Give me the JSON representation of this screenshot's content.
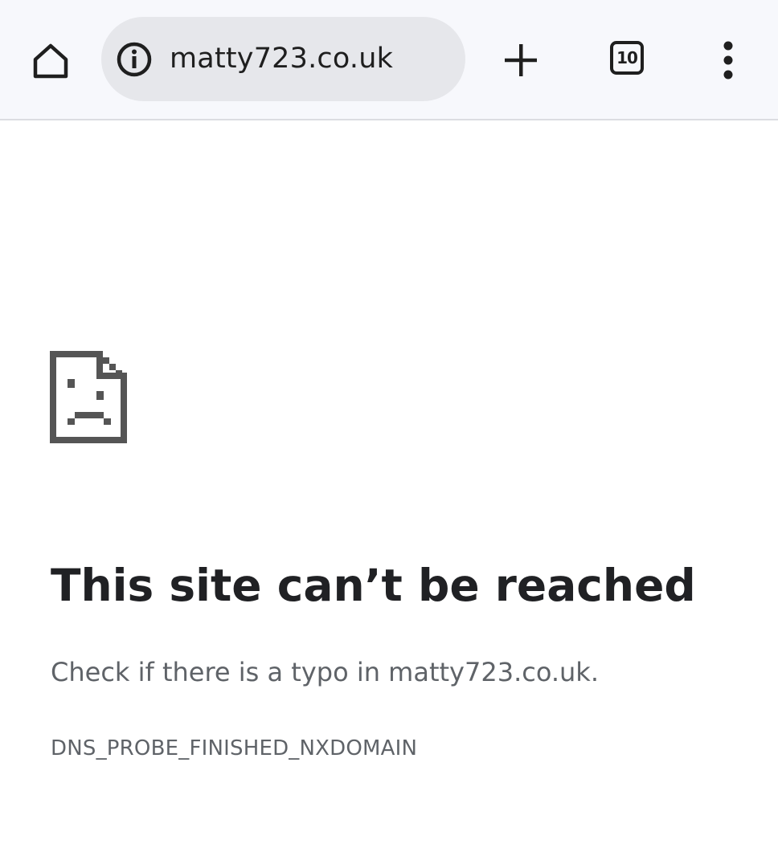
{
  "toolbar": {
    "home_icon": "home-icon",
    "site_info_icon": "info-icon",
    "url": "matty723.co.uk",
    "new_tab_icon": "plus-icon",
    "tab_count": "10",
    "menu_icon": "more-vertical-icon"
  },
  "error_page": {
    "icon": "sad-page-icon",
    "title": "This site can’t be reached",
    "description": "Check if there is a typo in matty723.co.uk.",
    "error_code": "DNS_PROBE_FINISHED_NXDOMAIN"
  },
  "colors": {
    "toolbar_bg": "#f7f8fc",
    "omnibox_bg": "#e6e7eb",
    "title_text": "#202124",
    "secondary_text": "#5f6368",
    "icon_color": "#1f1f1f",
    "error_icon": "#555555"
  }
}
